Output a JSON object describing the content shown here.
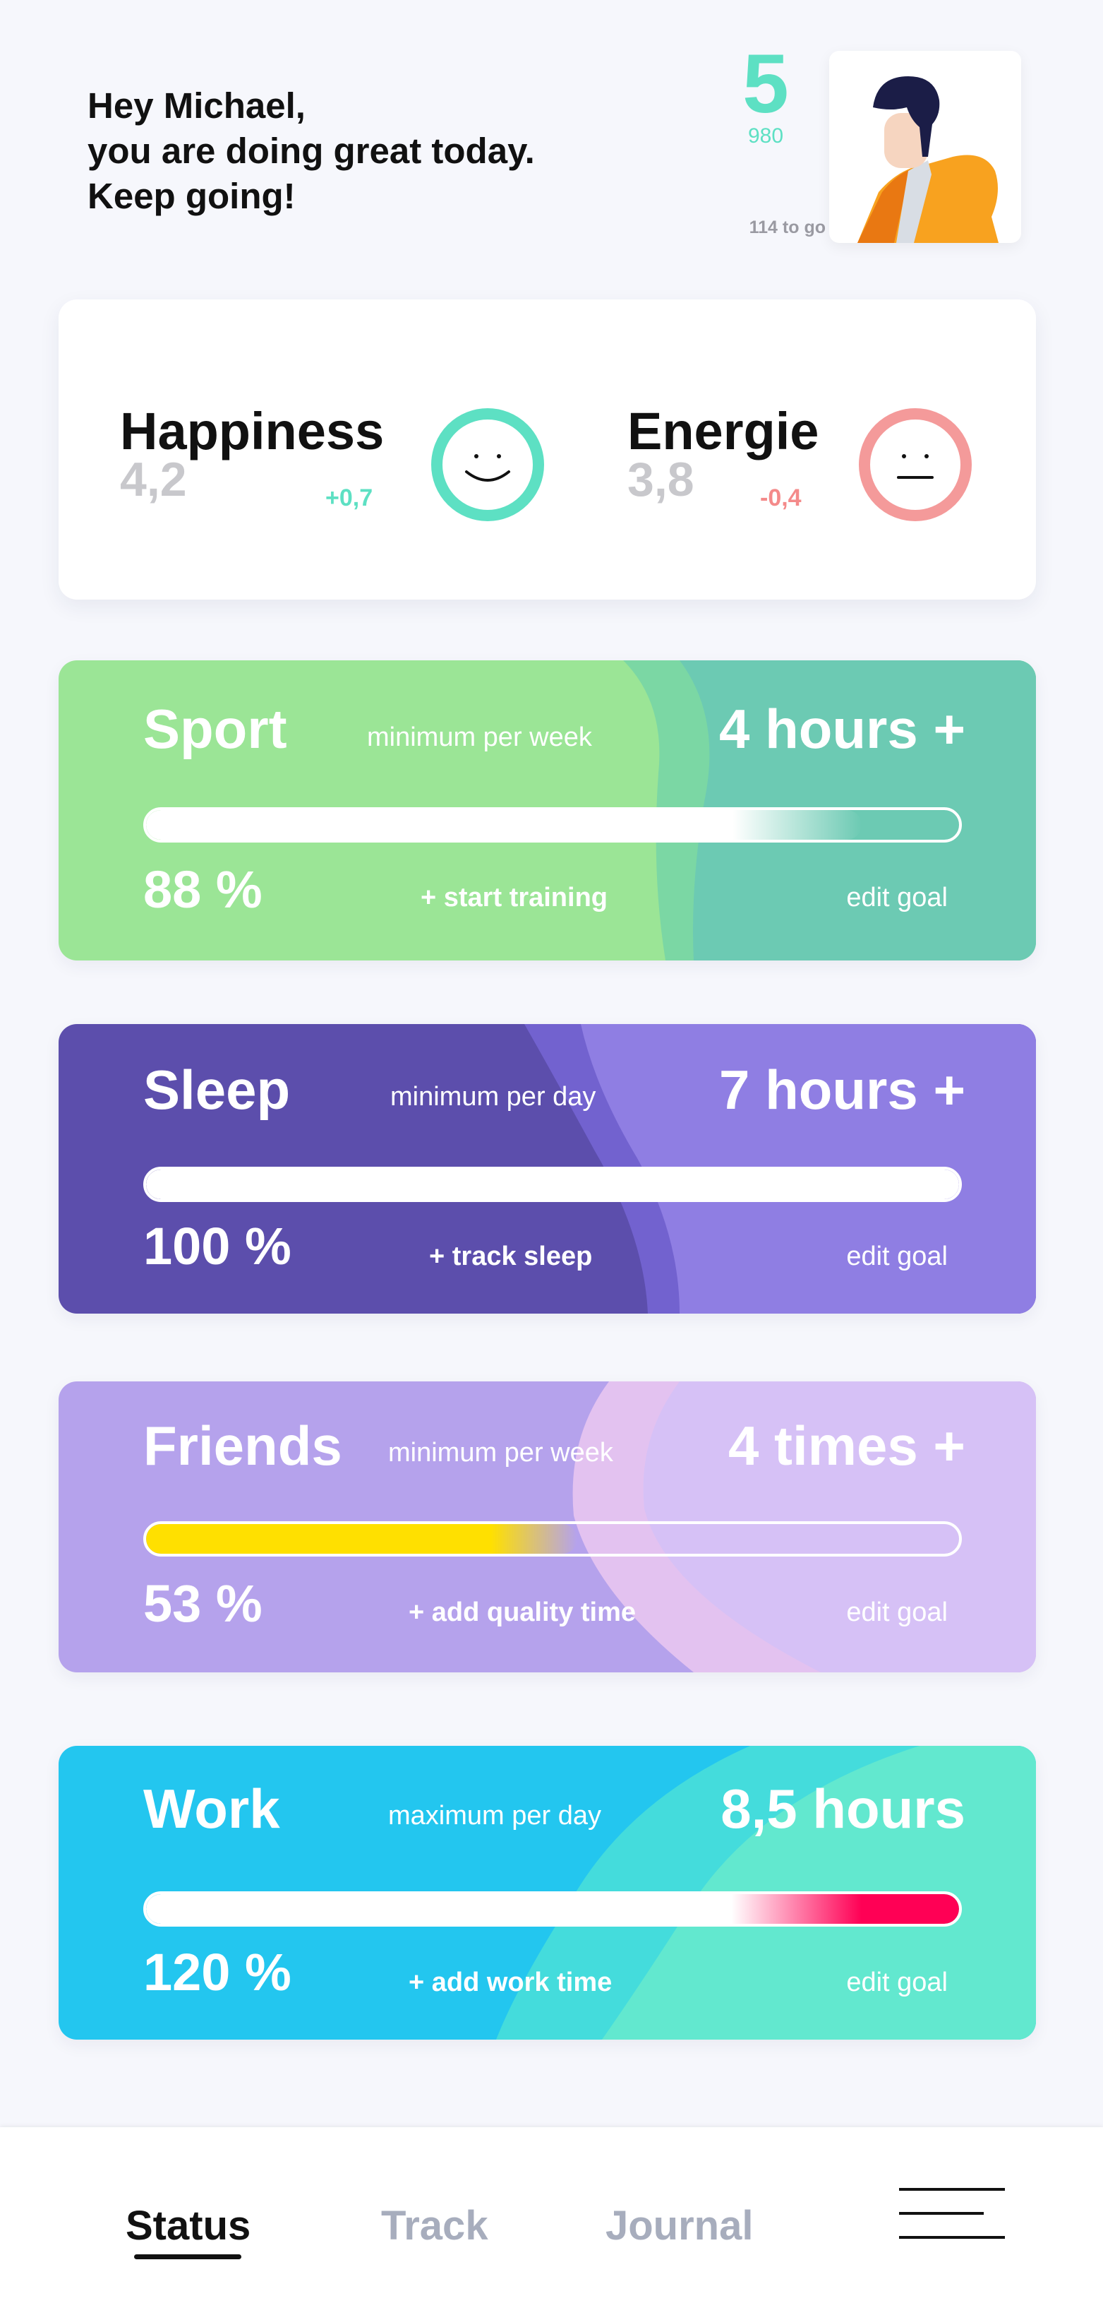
{
  "header": {
    "greeting_lines": [
      "Hey Michael,",
      "you are doing great today.",
      "Keep going!"
    ],
    "level": "5",
    "points": "980",
    "to_go": "114 to go",
    "avatar": "user-avatar-illustration"
  },
  "mood": {
    "happiness": {
      "title": "Happiness",
      "value": "4,2",
      "delta": "+0,7",
      "color": "#5de0c3",
      "icon": "smile-face-icon"
    },
    "energy": {
      "title": "Energie",
      "value": "3,8",
      "delta": "-0,4",
      "color": "#f49a9a",
      "icon": "neutral-face-icon"
    }
  },
  "goals": [
    {
      "title": "Sport",
      "subtitle": "minimum per week",
      "goal": "4 hours +",
      "percent": "88 %",
      "progress": 0.88,
      "action": "+ start training",
      "edit": "edit goal",
      "colors": [
        "#9be596",
        "#6ccab3"
      ],
      "fill": "#ffffff"
    },
    {
      "title": "Sleep",
      "subtitle": "minimum per day",
      "goal": "7 hours +",
      "percent": "100 %",
      "progress": 1.0,
      "action": "+ track sleep",
      "edit": "edit goal",
      "colors": [
        "#5c4eac",
        "#8f7ee3"
      ],
      "fill": "#ffffff"
    },
    {
      "title": "Friends",
      "subtitle": "minimum per week",
      "goal": "4 times +",
      "percent": "53 %",
      "progress": 0.53,
      "action": "+ add quality time",
      "edit": "edit goal",
      "colors": [
        "#b5a2ec",
        "#d6c1f6"
      ],
      "fill": "#ffe000"
    },
    {
      "title": "Work",
      "subtitle": "maximum per day",
      "goal": "8,5 hours",
      "percent": "120 %",
      "progress": 1.2,
      "action": "+ add work time",
      "edit": "edit goal",
      "colors": [
        "#23c6ef",
        "#62e8cf"
      ],
      "fill": "#ff0055"
    }
  ],
  "nav": {
    "items": [
      "Status",
      "Track",
      "Journal"
    ],
    "active": "Status",
    "menu_icon": "hamburger-menu-icon"
  }
}
